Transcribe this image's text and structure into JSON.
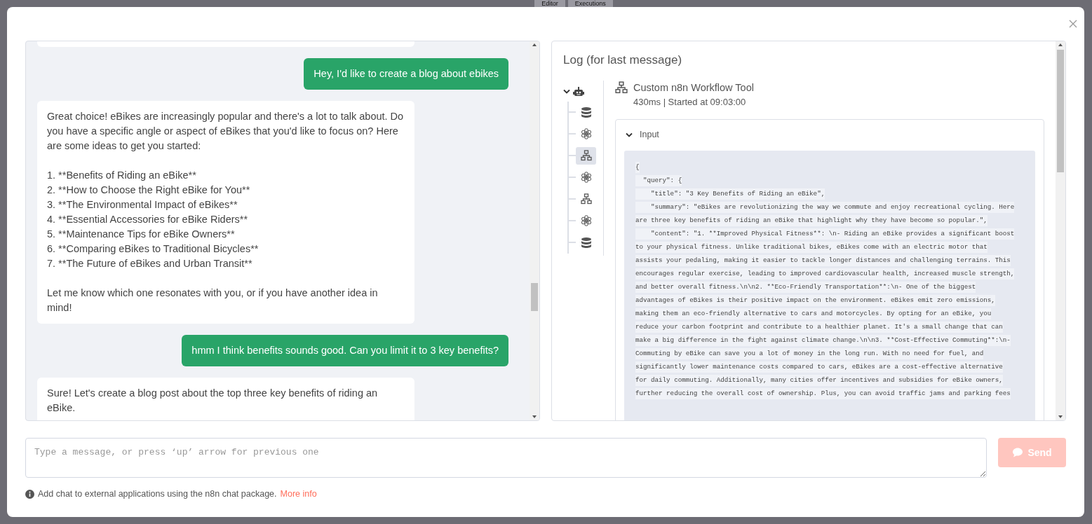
{
  "background": {
    "tabs": [
      {
        "label": "Editor"
      },
      {
        "label": "Executions"
      }
    ]
  },
  "chat": {
    "messages": [
      {
        "kind": "user",
        "text": "Hey, I'd like to create a blog about ebikes"
      },
      {
        "kind": "bot",
        "text": "Great choice! eBikes are increasingly popular and there's a lot to talk about. Do you have a specific angle or aspect of eBikes that you'd like to focus on? Here are some ideas to get you started:\n\n1. **Benefits of Riding an eBike**\n2. **How to Choose the Right eBike for You**\n3. **The Environmental Impact of eBikes**\n4. **Essential Accessories for eBike Riders**\n5. **Maintenance Tips for eBike Owners**\n6. **Comparing eBikes to Traditional Bicycles**\n7. **The Future of eBikes and Urban Transit**\n\nLet me know which one resonates with you, or if you have another idea in mind!"
      },
      {
        "kind": "user",
        "text": "hmm I think benefits sounds good. Can you limit it to 3 key benefits?"
      },
      {
        "kind": "bot",
        "text": "Sure! Let's create a blog post about the top three key benefits of riding an eBike."
      }
    ]
  },
  "log": {
    "title": "Log (for last message)",
    "tree": {
      "kind": "agent",
      "expanded": true,
      "children": [
        {
          "kind": "database",
          "selected": false
        },
        {
          "kind": "model",
          "selected": false
        },
        {
          "kind": "workflow",
          "selected": true
        },
        {
          "kind": "model",
          "selected": false
        },
        {
          "kind": "workflow",
          "selected": false
        },
        {
          "kind": "model",
          "selected": false
        },
        {
          "kind": "database",
          "selected": false
        }
      ]
    },
    "detail": {
      "kind": "workflow",
      "title": "Custom n8n Workflow Tool",
      "meta": "430ms | Started at 09:03:00",
      "input": {
        "label": "Input",
        "expanded": true,
        "lines": [
          "{",
          "  \"query\": {",
          "    \"title\": \"3 Key Benefits of Riding an eBike\",",
          "    \"summary\": \"eBikes are revolutionizing the way we commute and enjoy recreational cycling. Here",
          "are three key benefits of riding an eBike that highlight why they have become so popular.\",",
          "    \"content\": \"1. **Improved Physical Fitness**: \\n- Riding an eBike provides a significant boost",
          "to your physical fitness. Unlike traditional bikes, eBikes come with an electric motor that",
          "assists your pedaling, making it easier to tackle longer distances and challenging terrains. This",
          "encourages regular exercise, leading to improved cardiovascular health, increased muscle strength,",
          "and better overall fitness.\\n\\n2. **Eco-Friendly Transportation**:\\n- One of the biggest",
          "advantages of eBikes is their positive impact on the environment. eBikes emit zero emissions,",
          "making them an eco-friendly alternative to cars and motorcycles. By opting for an eBike, you",
          "reduce your carbon footprint and contribute to a healthier planet. It's a small change that can",
          "make a big difference in the fight against climate change.\\n\\n3. **Cost-Effective Commuting**:\\n-",
          "Commuting by eBike can save you a lot of money in the long run. With no need for fuel, and",
          "significantly lower maintenance costs compared to cars, eBikes are a cost-effective alternative",
          "for daily commuting. Additionally, many cities offer incentives and subsidies for eBike owners,",
          "further reducing the overall cost of ownership. Plus, you can avoid traffic jams and parking fees"
        ]
      }
    }
  },
  "composer": {
    "placeholder": "Type a message, or press ‘up’ arrow for previous one",
    "send_button": {
      "label": "Send",
      "disabled": true
    }
  },
  "footer": {
    "text": "Add chat to external applications using the n8n chat package.",
    "link": "More info"
  }
}
